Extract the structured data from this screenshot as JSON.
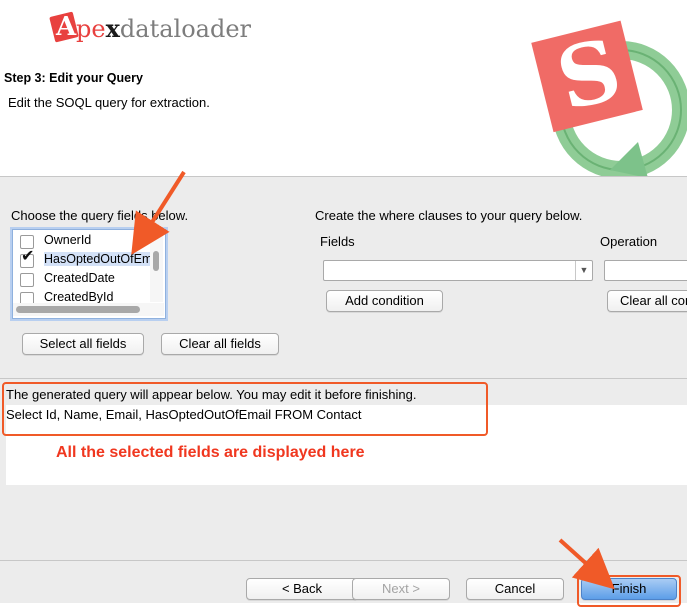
{
  "header": {
    "logo_text": "Apexdataloader",
    "step_title": "Step 3: Edit your Query",
    "step_description": "Edit the SOQL query for extraction."
  },
  "field_chooser": {
    "label": "Choose the query fields below.",
    "fields": [
      {
        "name": "OwnerId",
        "checked": false,
        "selected": false
      },
      {
        "name": "HasOptedOutOfEmail",
        "checked": true,
        "selected": true
      },
      {
        "name": "CreatedDate",
        "checked": false,
        "selected": false
      },
      {
        "name": "CreatedById",
        "checked": false,
        "selected": false
      }
    ],
    "select_all_label": "Select all fields",
    "clear_all_label": "Clear all fields"
  },
  "where_clause": {
    "label": "Create the where clauses to your query below.",
    "fields_label": "Fields",
    "operation_label": "Operation",
    "field_select_value": "",
    "operation_value": "",
    "add_condition_label": "Add condition",
    "clear_all_label": "Clear all conditions"
  },
  "query": {
    "info_text": "The generated query will appear below.  You may edit it before finishing.",
    "text": "Select Id, Name, Email, HasOptedOutOfEmail FROM Contact"
  },
  "annotation": {
    "text": "All the selected fields are displayed here",
    "color": "#f0371f"
  },
  "footer": {
    "back_label": "< Back",
    "next_label": "Next >",
    "cancel_label": "Cancel",
    "finish_label": "Finish"
  },
  "colors": {
    "brand_red": "#e8413f",
    "brand_green": "#7dc28a",
    "highlight_orange": "#f05a28",
    "primary_button": "#5d9ee8"
  }
}
